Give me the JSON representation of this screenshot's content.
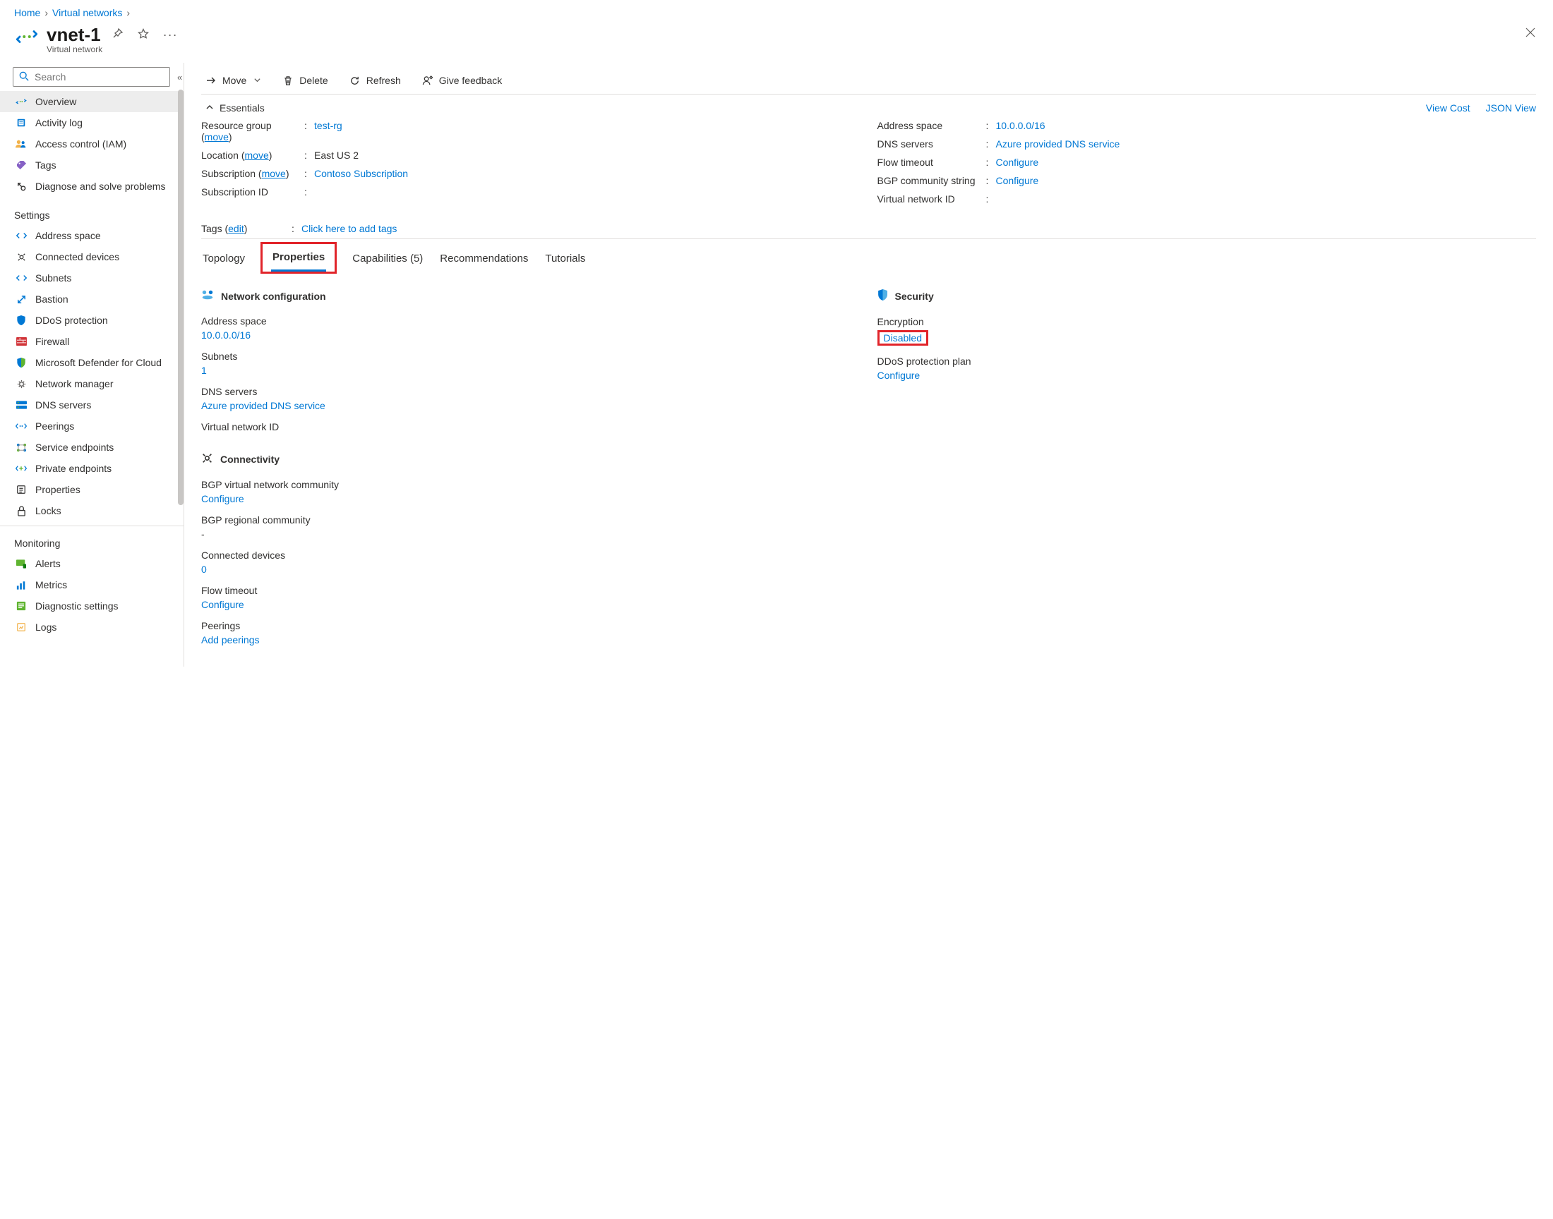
{
  "breadcrumb": {
    "home": "Home",
    "vnets": "Virtual networks"
  },
  "header": {
    "title": "vnet-1",
    "subtitle": "Virtual network"
  },
  "search": {
    "placeholder": "Search"
  },
  "nav": {
    "top": [
      {
        "label": "Overview"
      },
      {
        "label": "Activity log"
      },
      {
        "label": "Access control (IAM)"
      },
      {
        "label": "Tags"
      },
      {
        "label": "Diagnose and solve problems"
      }
    ],
    "settings_h": "Settings",
    "settings": [
      {
        "label": "Address space"
      },
      {
        "label": "Connected devices"
      },
      {
        "label": "Subnets"
      },
      {
        "label": "Bastion"
      },
      {
        "label": "DDoS protection"
      },
      {
        "label": "Firewall"
      },
      {
        "label": "Microsoft Defender for Cloud"
      },
      {
        "label": "Network manager"
      },
      {
        "label": "DNS servers"
      },
      {
        "label": "Peerings"
      },
      {
        "label": "Service endpoints"
      },
      {
        "label": "Private endpoints"
      },
      {
        "label": "Properties"
      },
      {
        "label": "Locks"
      }
    ],
    "monitoring_h": "Monitoring",
    "monitoring": [
      {
        "label": "Alerts"
      },
      {
        "label": "Metrics"
      },
      {
        "label": "Diagnostic settings"
      },
      {
        "label": "Logs"
      }
    ]
  },
  "toolbar": {
    "move": "Move",
    "delete": "Delete",
    "refresh": "Refresh",
    "feedback": "Give feedback"
  },
  "ess": {
    "head": "Essentials",
    "viewcost": "View Cost",
    "jsonview": "JSON View",
    "moveTxt": "move",
    "left": {
      "rg_l": "Resource group",
      "rg_v": "test-rg",
      "loc_l": "Location",
      "loc_v": "East US 2",
      "sub_l": "Subscription",
      "sub_v": "Contoso Subscription",
      "sid_l": "Subscription ID",
      "sid_v": ""
    },
    "right": {
      "as_l": "Address space",
      "as_v": "10.0.0.0/16",
      "dns_l": "DNS servers",
      "dns_v": "Azure provided DNS service",
      "ft_l": "Flow timeout",
      "ft_v": "Configure",
      "bgp_l": "BGP community string",
      "bgp_v": "Configure",
      "vid_l": "Virtual network ID",
      "vid_v": ""
    },
    "tags_l": "Tags",
    "tags_edit": "edit",
    "tags_v": "Click here to add tags"
  },
  "tabs": {
    "topology": "Topology",
    "properties": "Properties",
    "capabilities": "Capabilities (5)",
    "recommendations": "Recommendations",
    "tutorials": "Tutorials"
  },
  "netcfg": {
    "h": "Network configuration",
    "as_l": "Address space",
    "as_v": "10.0.0.0/16",
    "sn_l": "Subnets",
    "sn_v": "1",
    "dns_l": "DNS servers",
    "dns_v": "Azure provided DNS service",
    "vid_l": "Virtual network ID"
  },
  "security": {
    "h": "Security",
    "enc_l": "Encryption",
    "enc_v": "Disabled",
    "ddos_l": "DDoS protection plan",
    "ddos_v": "Configure"
  },
  "connect": {
    "h": "Connectivity",
    "bgpv_l": "BGP virtual network community",
    "bgpv_v": "Configure",
    "bgpr_l": "BGP regional community",
    "bgpr_v": "-",
    "cd_l": "Connected devices",
    "cd_v": "0",
    "ft_l": "Flow timeout",
    "ft_v": "Configure",
    "peer_l": "Peerings",
    "peer_v": "Add peerings"
  }
}
